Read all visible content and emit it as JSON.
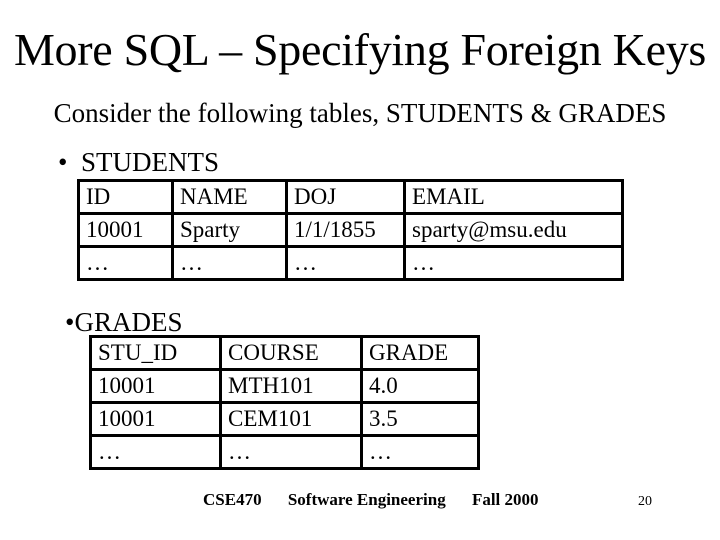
{
  "slide": {
    "title": "More SQL – Specifying Foreign Keys",
    "subtitle": "Consider the following tables, STUDENTS & GRADES",
    "bullets": [
      {
        "marker": "•",
        "label": "STUDENTS"
      },
      {
        "marker": "•",
        "label": "GRADES"
      }
    ]
  },
  "students_table": {
    "headers": [
      "ID",
      "NAME",
      "DOJ",
      "EMAIL"
    ],
    "rows": [
      [
        "10001",
        "Sparty",
        "1/1/1855",
        "sparty@msu.edu"
      ],
      [
        "…",
        "…",
        "…",
        "…"
      ]
    ]
  },
  "grades_table": {
    "headers": [
      "STU_ID",
      "COURSE",
      "GRADE"
    ],
    "rows": [
      [
        "10001",
        "MTH101",
        "4.0"
      ],
      [
        "10001",
        "CEM101",
        "3.5"
      ],
      [
        "…",
        "…",
        "…"
      ]
    ]
  },
  "footer": {
    "course": "CSE470",
    "subject": "Software Engineering",
    "term": "Fall 2000",
    "page_number": "20"
  }
}
